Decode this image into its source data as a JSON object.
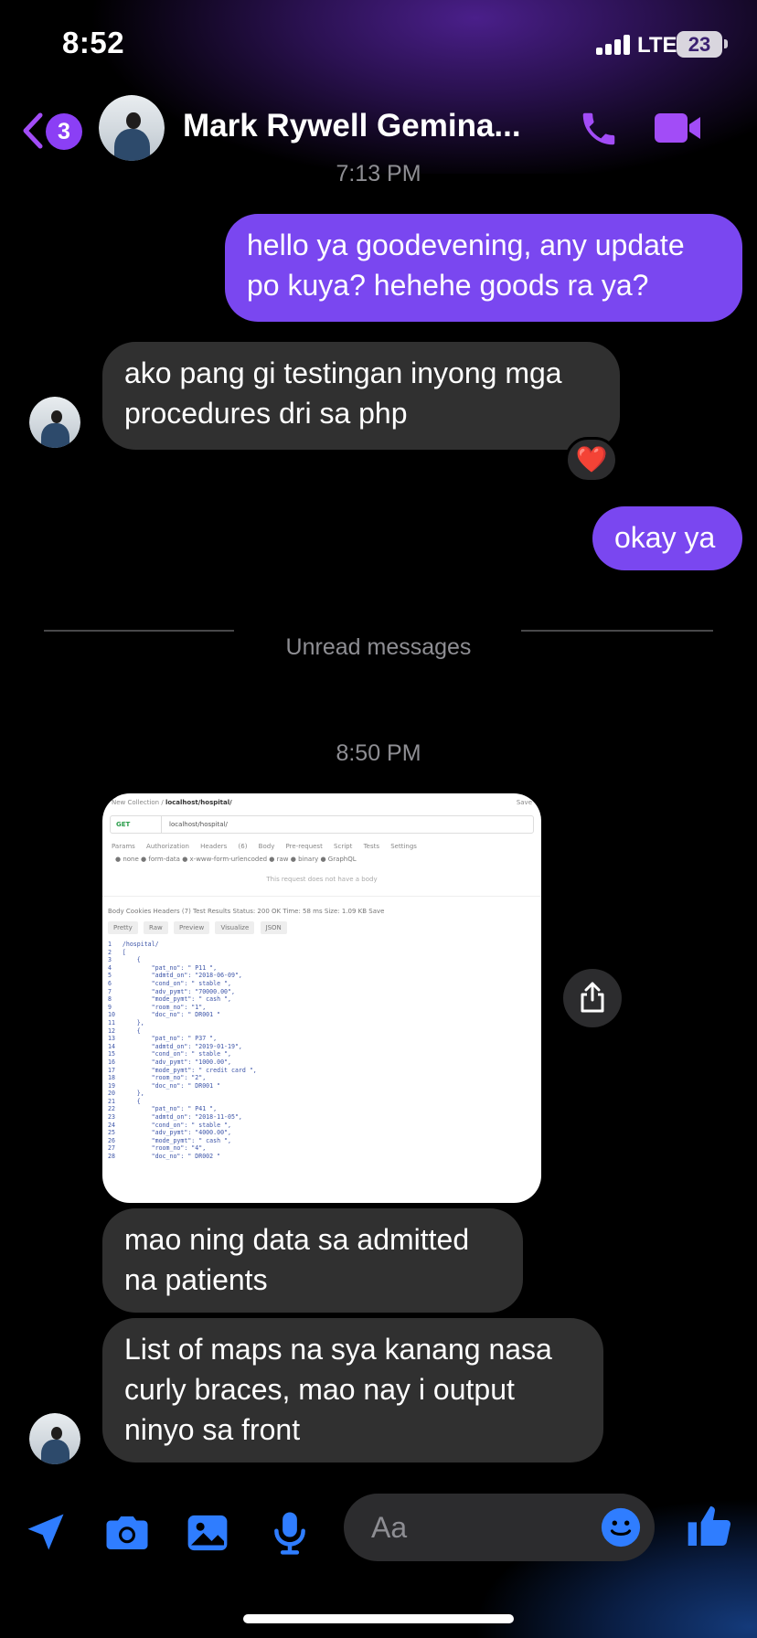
{
  "status": {
    "time": "8:52",
    "network": "LTE",
    "battery": "23"
  },
  "header": {
    "back_badge": "3",
    "contact_name": "Mark Rywell Gemina..."
  },
  "timestamps": {
    "first": "7:13 PM",
    "second": "8:50 PM"
  },
  "messages": [
    {
      "direction": "outgoing",
      "text": "hello ya goodevening, any update po kuya? hehehe goods ra ya?"
    },
    {
      "direction": "incoming",
      "text": "ako pang gi testingan inyong mga procedures dri sa php",
      "reaction": "❤️"
    },
    {
      "direction": "outgoing",
      "text": "okay ya"
    },
    {
      "direction": "incoming",
      "text": "mao ning data sa admitted na patients"
    },
    {
      "direction": "incoming",
      "text": "List of maps na sya kanang nasa curly braces, mao nay i output ninyo sa front"
    }
  ],
  "unread_label": "Unread messages",
  "attachment": {
    "breadcrumb_a": "New Collection",
    "breadcrumb_b": "localhost/hospital/",
    "save": "Save",
    "method": "GET",
    "url": "localhost/hospital/",
    "tabs": "Params  Authorization  Headers (6)  Body  Pre-request Script  Tests  Settings",
    "radio": "● none  ● form-data  ● x-www-form-urlencoded  ● raw  ● binary  ● GraphQL",
    "note": "This request does not have a body",
    "response_bar": "Body  Cookies  Headers (7)  Test Results          Status: 200 OK  Time: 58 ms  Size: 1.09 KB  Save",
    "view_modes": [
      "Pretty",
      "Raw",
      "Preview",
      "Visualize",
      "JSON"
    ],
    "code": "1   /hospital/\n2   [\n3       {\n4           \"pat_no\": \" P11 \",\n5           \"admtd_on\": \"2018-06-09\",\n6           \"cond_on\": \" stable \",\n7           \"adv_pymt\": \"70000.00\",\n8           \"mode_pymt\": \" cash \",\n9           \"room_no\": \"1\",\n10          \"doc_no\": \" DR001 \"\n11      },\n12      {\n13          \"pat_no\": \" P37 \",\n14          \"admtd_on\": \"2019-01-19\",\n15          \"cond_on\": \" stable \",\n16          \"adv_pymt\": \"1000.00\",\n17          \"mode_pymt\": \" credit card \",\n18          \"room_no\": \"2\",\n19          \"doc_no\": \" DR001 \"\n20      },\n21      {\n22          \"pat_no\": \" P41 \",\n23          \"admtd_on\": \"2018-11-05\",\n24          \"cond_on\": \" stable \",\n25          \"adv_pymt\": \"4000.00\",\n26          \"mode_pymt\": \" cash \",\n27          \"room_no\": \"4\",\n28          \"doc_no\": \" DR002 \""
  },
  "composer": {
    "placeholder": "Aa"
  },
  "icons": [
    "back-chevron-icon",
    "phone-icon",
    "video-camera-icon",
    "heart-icon",
    "share-icon",
    "location-arrow-icon",
    "camera-icon",
    "photo-icon",
    "microphone-icon",
    "emoji-icon",
    "thumbs-up-icon"
  ],
  "colors": {
    "accent": "#7a47f0",
    "incoming_bubble": "#303030",
    "composer_icons": "#2f7dff",
    "header_icons": "#a24cf7"
  }
}
